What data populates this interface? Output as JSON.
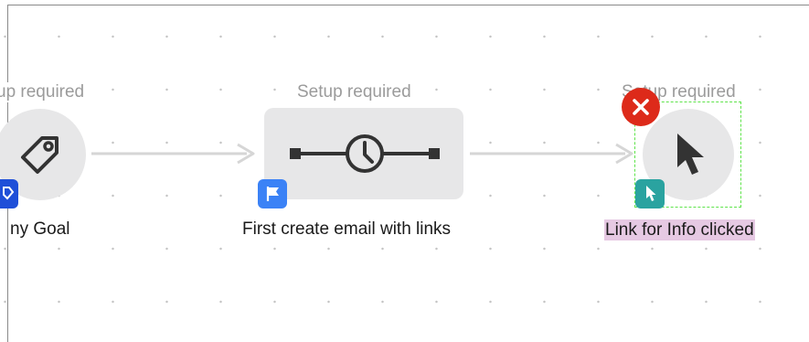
{
  "nodes": [
    {
      "id": "goal",
      "status": "up required",
      "label": "ny Goal",
      "icon": "tag-icon",
      "badge_icon": "goal-badge-icon"
    },
    {
      "id": "wait",
      "status": "Setup required",
      "label": "First create email with links",
      "icon": "wait-timeline-icon",
      "badge_icon": "flag-icon"
    },
    {
      "id": "link-click",
      "status": "Setup required",
      "label": "Link for Info clicked",
      "icon": "cursor-icon",
      "badge_icon": "cursor-badge-icon",
      "selected": true
    }
  ],
  "colors": {
    "node_fill": "#e7e7e8",
    "arrow": "#d6d6d6",
    "status_text": "#9b9b9b",
    "flag_badge": "#3b82f6",
    "cursor_badge": "#2aa3a0",
    "goal_badge": "#1f4fd8",
    "delete": "#dd2a1a",
    "selection": "#5ee34a",
    "label_highlight": "#e6c9e3"
  }
}
